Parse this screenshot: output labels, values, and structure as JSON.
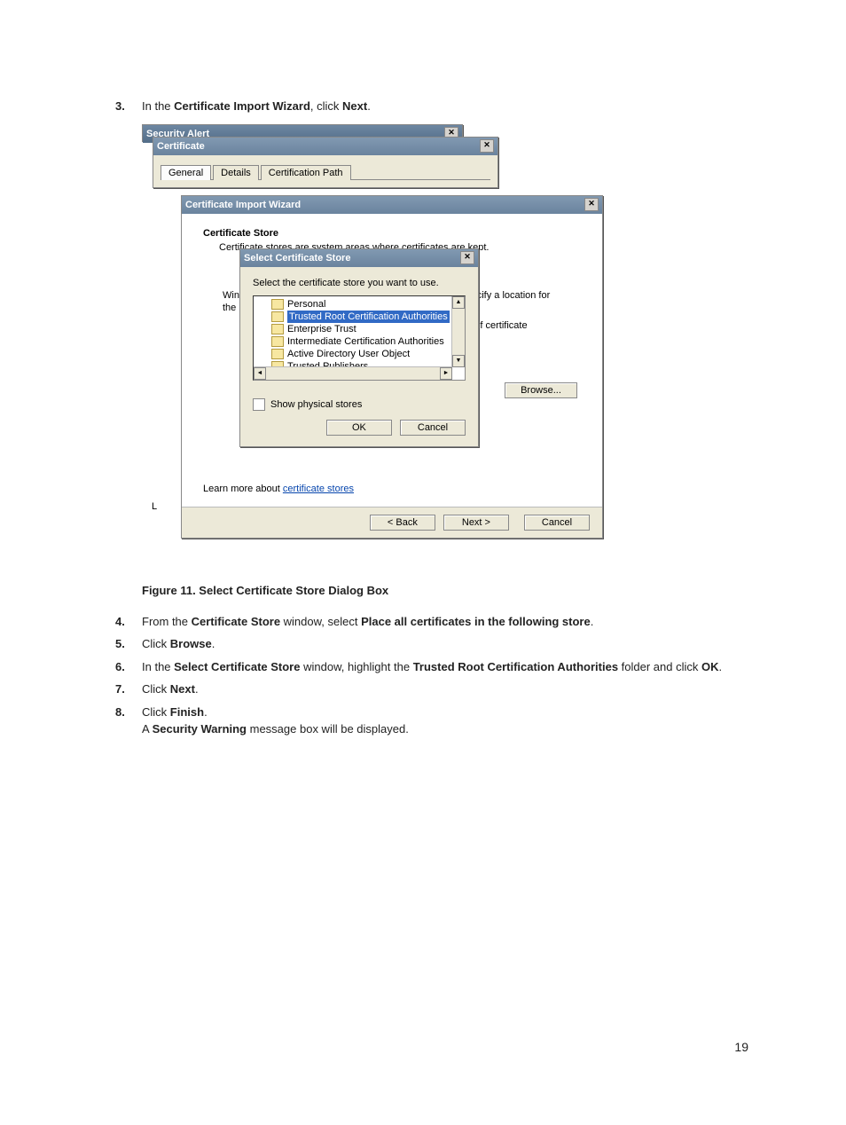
{
  "steps": {
    "s3": {
      "num": "3.",
      "pre": "In the ",
      "b1": "Certificate Import Wizard",
      "mid": ", click ",
      "b2": "Next",
      "post": "."
    },
    "s4": {
      "num": "4.",
      "pre": "From the ",
      "b1": "Certificate Store",
      "mid": " window, select ",
      "b2": "Place all certificates in the following store",
      "post": "."
    },
    "s5": {
      "num": "5.",
      "pre": "Click ",
      "b1": "Browse",
      "post": "."
    },
    "s6": {
      "num": "6.",
      "pre": "In the ",
      "b1": "Select Certificate Store",
      "mid": " window, highlight the ",
      "b2": "Trusted Root Certification Authorities",
      "mid2": " folder and click ",
      "b3": "OK",
      "post": "."
    },
    "s7": {
      "num": "7.",
      "pre": "Click ",
      "b1": "Next",
      "post": "."
    },
    "s8": {
      "num": "8.",
      "line1_pre": "Click ",
      "line1_b": "Finish",
      "line1_post": ".",
      "line2_pre": "A ",
      "line2_b": "Security Warning",
      "line2_post": " message box will be displayed."
    }
  },
  "figure_caption": "Figure 11. Select Certificate Store Dialog Box",
  "page_number": "19",
  "win_security_alert": {
    "title": "Security Alert"
  },
  "win_certificate": {
    "title": "Certificate",
    "tabs": {
      "general": "General",
      "details": "Details",
      "certpath": "Certification Path"
    }
  },
  "win_wizard": {
    "title": "Certificate Import Wizard",
    "heading": "Certificate Store",
    "desc": "Certificate stores are system areas where certificates are kept.",
    "frag_left1": "Win",
    "frag_left2": "the",
    "frag_right1": "specify a location for",
    "frag_right2": "pe of certificate",
    "browse": "Browse...",
    "learn_pre": "Learn more about ",
    "learn_link": "certificate stores",
    "back": "< Back",
    "next": "Next >",
    "cancel": "Cancel",
    "partial_L": "L"
  },
  "win_store": {
    "title": "Select Certificate Store",
    "prompt": "Select the certificate store you want to use.",
    "items": {
      "i0": "Personal",
      "i1": "Trusted Root Certification Authorities",
      "i2": "Enterprise Trust",
      "i3": "Intermediate Certification Authorities",
      "i4": "Active Directory User Object",
      "i5": "Trusted Publishers"
    },
    "show_physical": "Show physical stores",
    "ok": "OK",
    "cancel": "Cancel"
  }
}
